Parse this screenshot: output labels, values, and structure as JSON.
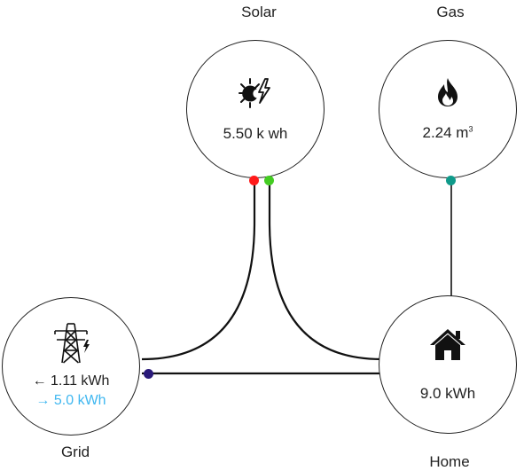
{
  "nodes": {
    "solar": {
      "label": "Solar",
      "value": "5.50 k wh"
    },
    "gas": {
      "label": "Gas",
      "value_number": "2.24 m",
      "value_unit_sup": "3"
    },
    "grid": {
      "label": "Grid",
      "import_arrow": "←",
      "import_value": "1.11 kWh",
      "export_arrow": "→",
      "export_value": "5.0 kWh"
    },
    "home": {
      "label": "Home",
      "value": "9.0 kWh"
    }
  },
  "icons": {
    "solar": "sun-lightning-icon",
    "gas": "flame-icon",
    "grid": "transmission-tower-icon",
    "home": "house-icon"
  },
  "colors": {
    "solar_dot_red": "#ff1a1a",
    "solar_dot_green": "#44cc22",
    "gas_dot": "#0f9a8a",
    "grid_dot": "#2a1a7a",
    "grid_export_text": "#3fb7f0",
    "flow_line": "#111111"
  }
}
